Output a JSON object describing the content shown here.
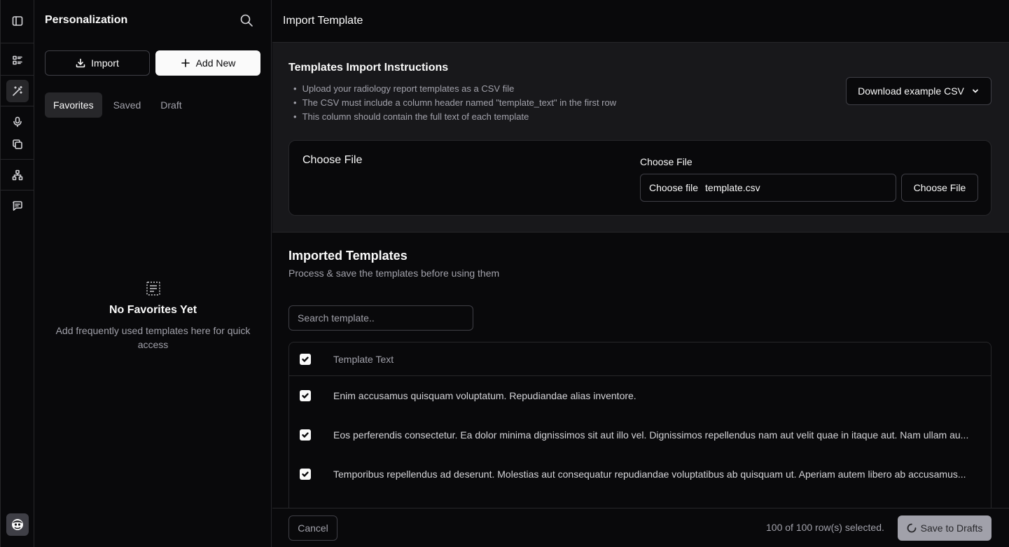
{
  "rail": {
    "items": [
      {
        "icon": "sidebar-toggle-icon"
      },
      {
        "icon": "list-icon"
      },
      {
        "icon": "magic-wand-icon",
        "active": true
      },
      {
        "icon": "microphone-icon"
      },
      {
        "icon": "copy-icon"
      },
      {
        "icon": "network-icon"
      },
      {
        "icon": "message-icon"
      }
    ]
  },
  "panel": {
    "title": "Personalization",
    "import_label": "Import",
    "add_new_label": "Add New",
    "tabs": [
      {
        "label": "Favorites",
        "active": true
      },
      {
        "label": "Saved",
        "active": false
      },
      {
        "label": "Draft",
        "active": false
      }
    ],
    "empty": {
      "title": "No Favorites Yet",
      "description": "Add frequently used templates here for quick access"
    }
  },
  "main": {
    "title": "Import Template",
    "instructions": {
      "title": "Templates Import Instructions",
      "items": [
        "Upload your radiology report templates as a CSV file",
        "The CSV must include a column header named \"template_text\" in the first row",
        "This column should contain the full text of each template"
      ],
      "download_label": "Download example CSV"
    },
    "file_card": {
      "heading": "Choose File",
      "field_label": "Choose File",
      "input_button": "Choose file",
      "file_name": "template.csv",
      "choose_button": "Choose File"
    },
    "imported": {
      "title": "Imported Templates",
      "subtitle": "Process & save the templates before using them",
      "search_placeholder": "Search template..",
      "column_header": "Template Text",
      "rows": [
        "Enim accusamus quisquam voluptatum. Repudiandae alias inventore.",
        "Eos perferendis consectetur. Ea dolor minima dignissimos sit aut illo vel. Dignissimos repellendus nam aut velit quae in itaque aut. Nam ullam au...",
        "Temporibus repellendus ad deserunt. Molestias aut consequatur repudiandae voluptatibus ab quisquam ut. Aperiam autem libero ab accusamus..."
      ]
    },
    "footer": {
      "cancel_label": "Cancel",
      "selection_text": "100 of 100 row(s) selected.",
      "save_label": "Save to Drafts"
    }
  },
  "colors": {
    "background": "#09090b",
    "surface": "#18181b",
    "border": "#27272a",
    "primary": "#fafafa",
    "muted": "#a1a1aa"
  }
}
